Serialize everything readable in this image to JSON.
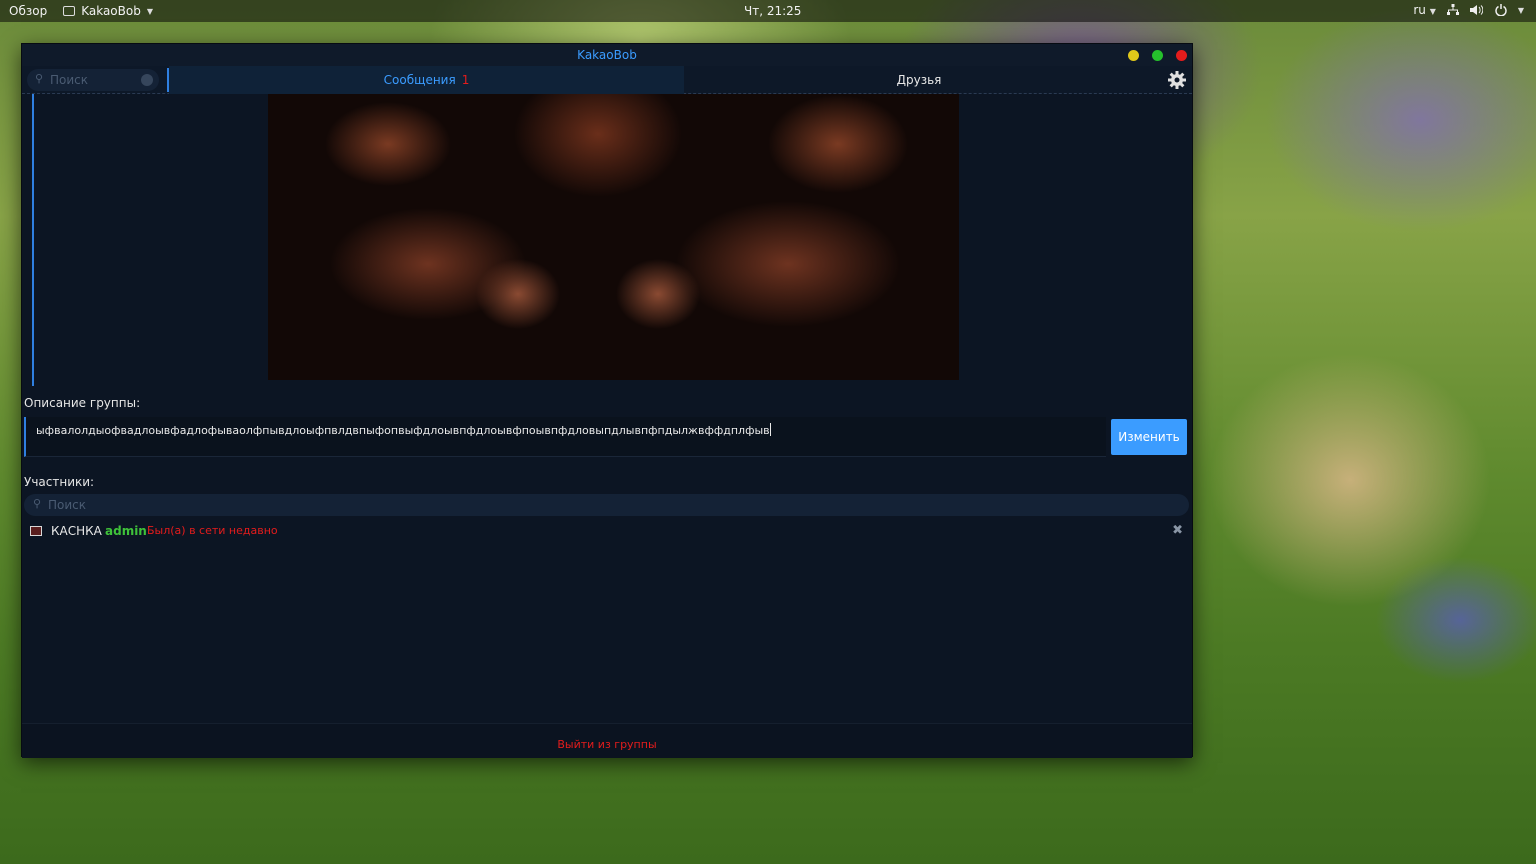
{
  "topbar": {
    "activities": "Обзор",
    "app_name": "KakaoBob",
    "clock": "Чт, 21:25",
    "language": "ru"
  },
  "window": {
    "title": "KakaoBob"
  },
  "tabs": {
    "search_placeholder": "Поиск",
    "messages_label": "Сообщения",
    "messages_badge": "1",
    "friends_label": "Друзья"
  },
  "group": {
    "description_label": "Описание группы:",
    "description_value": "ыфвалолдыофвадлоывфадлофываолфпывдлоыфпвлдвпыфопвыфдлоывпфдлоывфпоывпфдловыпдлывпфпдылжвффдплфыв",
    "change_button": "Изменить",
    "members_label": "Участники:",
    "members_search_placeholder": "Поиск",
    "members": [
      {
        "name": "КАСНКА",
        "role": "admin",
        "status": "Был(а) в сети недавно"
      }
    ],
    "leave_label": "Выйти из группы"
  },
  "colors": {
    "accent": "#3b9cff",
    "danger": "#e41c1c",
    "role": "#3fc23a",
    "window_bg": "#0c1523"
  },
  "icons": [
    "search-icon",
    "gear-icon",
    "close-icon",
    "network-icon",
    "volume-icon",
    "power-icon",
    "chevron-down-icon"
  ]
}
